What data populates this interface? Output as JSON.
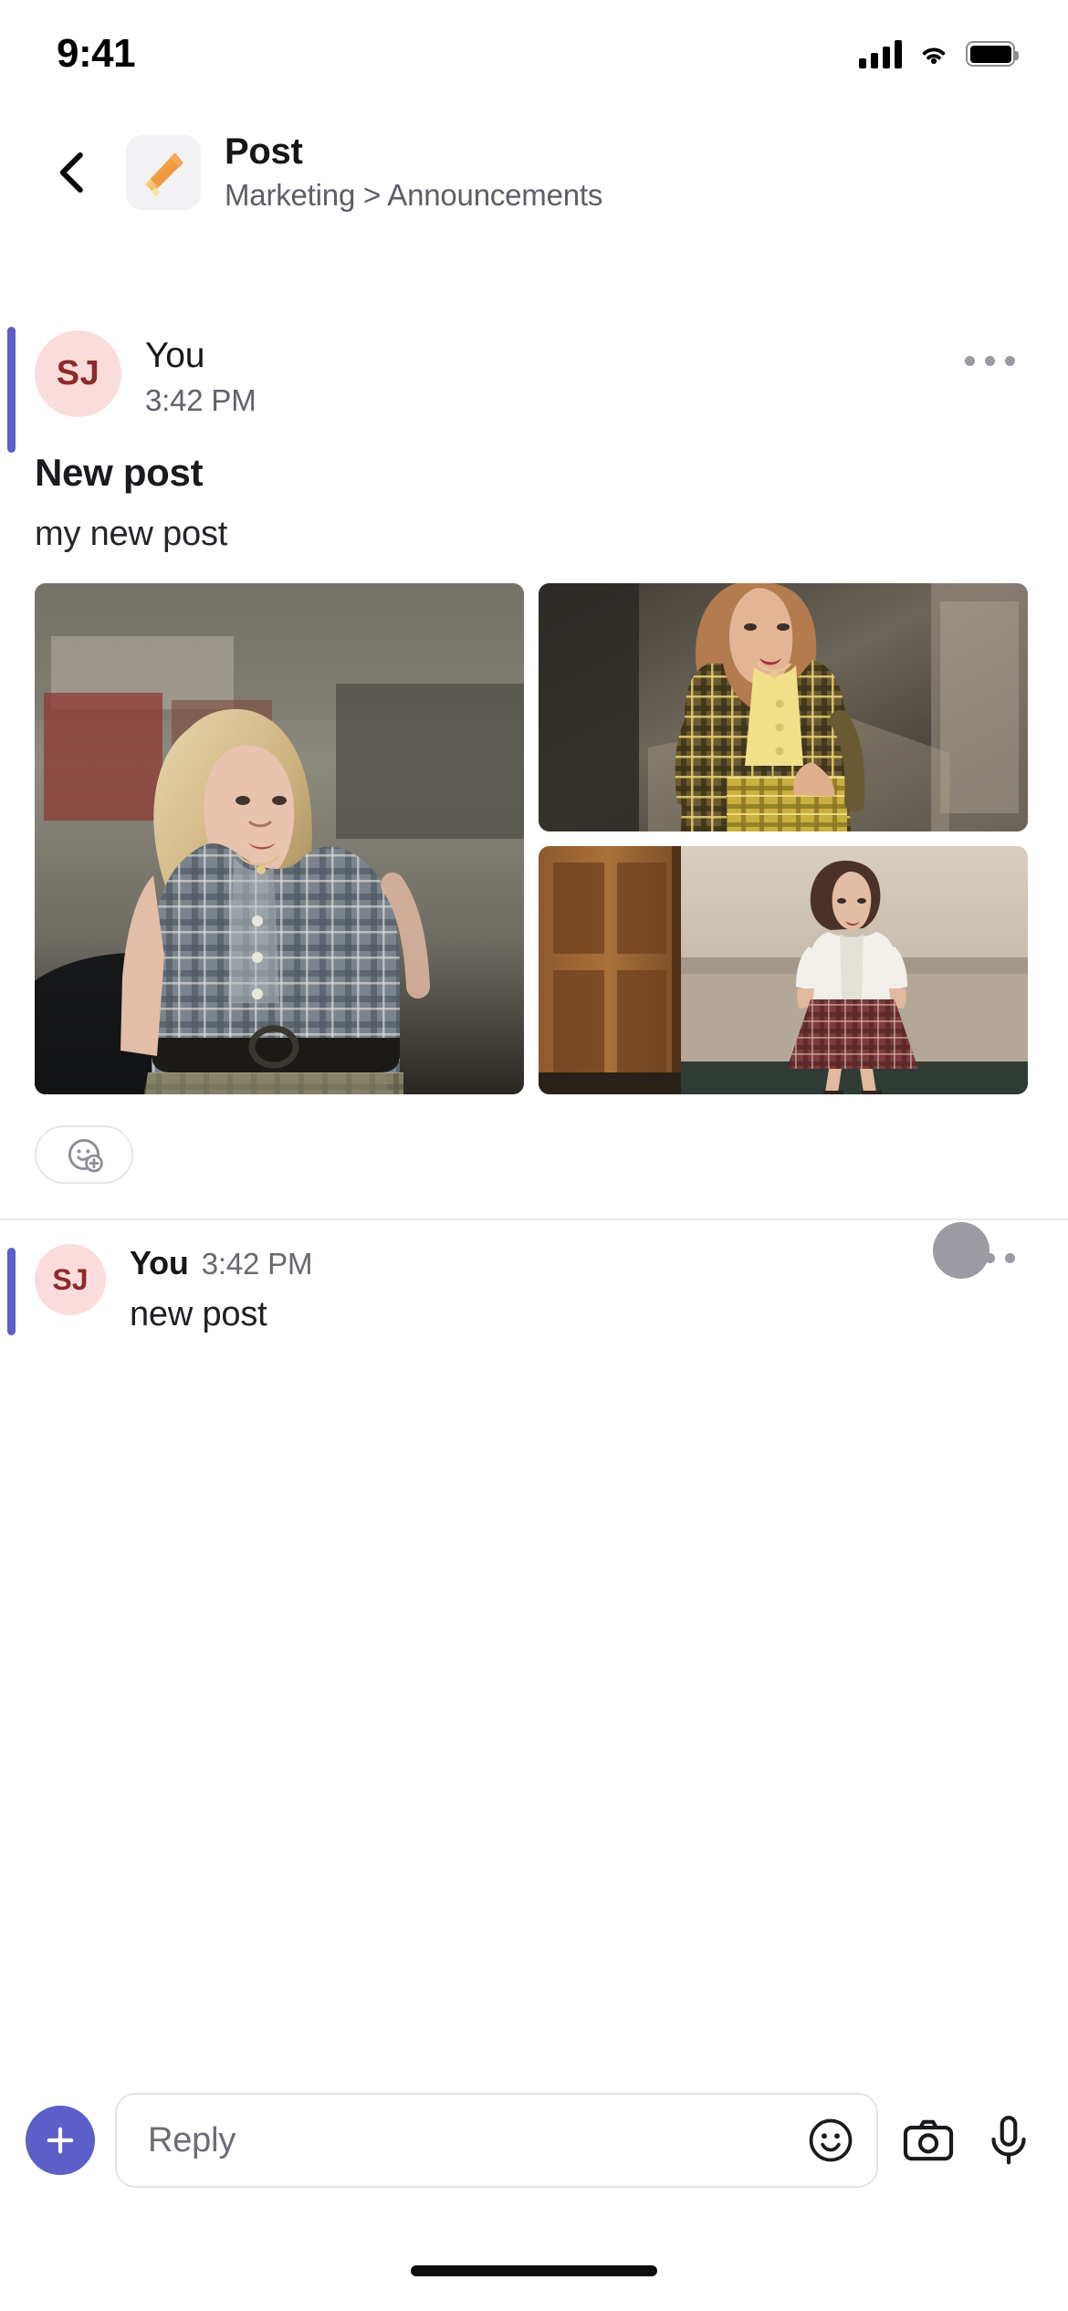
{
  "status_bar": {
    "time": "9:41",
    "signal_icon": "cellular-signal-icon",
    "wifi_icon": "wifi-icon",
    "battery_icon": "battery-icon"
  },
  "header": {
    "back_icon": "chevron-left-icon",
    "app_icon": "megaphone-icon",
    "title": "Post",
    "breadcrumb": "Marketing > Announcements"
  },
  "post": {
    "accent_color": "#5b5fc7",
    "avatar_initials": "SJ",
    "avatar_bg": "#fadcdc",
    "avatar_fg": "#8e2a2a",
    "author": "You",
    "timestamp": "3:42 PM",
    "more_icon": "more-options-icon",
    "title": "New post",
    "body": "my new post",
    "attachments": [
      {
        "name": "photo-blonde-woman-plaid-shirt",
        "alt": "Woman in grey plaid shirt outdoors"
      },
      {
        "name": "photo-yellow-plaid-suit",
        "alt": "Woman in yellow plaid blazer and skirt"
      },
      {
        "name": "photo-burgundy-plaid-skirt",
        "alt": "Woman in white blouse and burgundy plaid skirt"
      }
    ],
    "add_reaction_icon": "add-reaction-icon"
  },
  "reply": {
    "accent_color": "#5b5fc7",
    "avatar_initials": "SJ",
    "author": "You",
    "timestamp": "3:42 PM",
    "text": "new post",
    "more_icon": "more-options-icon",
    "touch_indicator": "touch-point-indicator"
  },
  "composer": {
    "add_icon": "plus-icon",
    "add_color": "#5b5fc7",
    "placeholder": "Reply",
    "value": "",
    "emoji_icon": "emoji-smiley-icon",
    "camera_icon": "camera-icon",
    "mic_icon": "microphone-icon"
  },
  "home_indicator": "home-indicator"
}
